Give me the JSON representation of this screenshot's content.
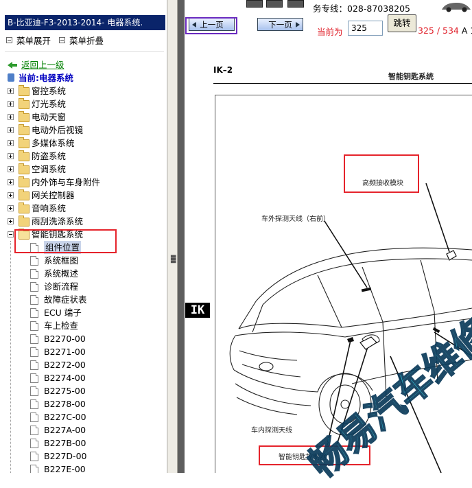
{
  "left_pane": {
    "title": "B-比亚迪-F3-2013-2014- 电器系统.",
    "toolbar": {
      "expand": "菜单展开",
      "collapse": "菜单折叠"
    },
    "back_link": "返回上一级",
    "current": "当前:电器系统",
    "folders": [
      "窗控系统",
      "灯光系统",
      "电动天窗",
      "电动外后视镜",
      "多媒体系统",
      "防盗系统",
      "空调系统",
      "内外饰与车身附件",
      "网关控制器",
      "音响系统",
      "雨刮洗涤系统"
    ],
    "open_folder": "智能钥匙系统",
    "documents": [
      "组件位置",
      "系统框图",
      "系统概述",
      "诊断流程",
      "故障症状表",
      "ECU 端子",
      "车上检查",
      "B2270-00",
      "B2271-00",
      "B2272-00",
      "B2274-00",
      "B2275-00",
      "B2278-00",
      "B227C-00",
      "B227A-00",
      "B227B-00",
      "B227D-00",
      "B227E-00"
    ],
    "selected_document": "组件位置"
  },
  "top_strip": {
    "hotline": "务专线：028-87038205"
  },
  "nav": {
    "prev_label": "上一页",
    "next_label": "下一页",
    "current_label": "当前为",
    "page_value": "325",
    "jump_label": "跳转",
    "page_total": "325 / 534",
    "page_total_tail": "A 1"
  },
  "document": {
    "side_tab": "IK",
    "page_code": "IK–2",
    "page_heading": "智能钥匙系统",
    "labels": {
      "receiver": "高频接收模块",
      "ext_antenna": "车外探测天线（右前）",
      "int_antenna": "车内探测天线",
      "controller": "智能钥匙控制器"
    },
    "watermark": "畅易汽车维修"
  },
  "colors": {
    "title_bar": "#0a246a",
    "highlight_box": "#e5232b",
    "link_green": "#008000",
    "current_blue": "#0000c0",
    "watermark": "#1fc0d8"
  }
}
